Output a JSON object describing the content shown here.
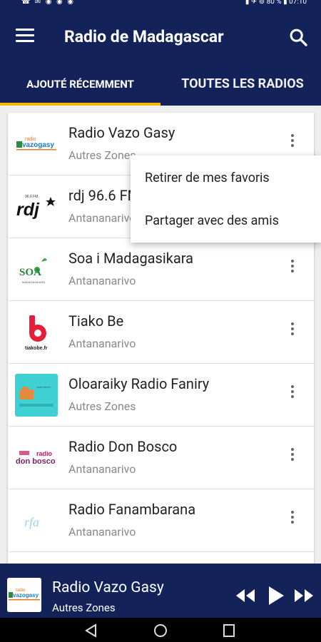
{
  "statusbar": {
    "left_icons": "☎ ✉ ◉ ◉ ◉",
    "right_text": "▮ ✈ ⊚ 80 % ▮ 07:10"
  },
  "appbar": {
    "title": "Radio de Madagascar"
  },
  "tabs": [
    {
      "label": "AJOUTÉ RÉCEMMENT",
      "active": true
    },
    {
      "label": "TOUTES LES RADIOS",
      "active": false
    }
  ],
  "stations": [
    {
      "name": "Radio Vazo Gasy",
      "location": "Autres Zones",
      "logo": "vazogasy-logo"
    },
    {
      "name": "rdj 96.6 FM",
      "location": "Antananarivo",
      "logo": "rdj-logo"
    },
    {
      "name": "Soa i Madagasikara",
      "location": "Antananarivo",
      "logo": "soa-logo"
    },
    {
      "name": "Tiako Be",
      "location": "Antananarivo",
      "logo": "tiakobe-logo"
    },
    {
      "name": "Oloaraiky Radio Faniry",
      "location": "Autres Zones",
      "logo": "faniry-logo"
    },
    {
      "name": "Radio Don Bosco",
      "location": "Antananarivo",
      "logo": "donbosco-logo"
    },
    {
      "name": "Radio Fanambarana",
      "location": "Antananarivo",
      "logo": "rfa-logo"
    }
  ],
  "logos": {
    "vazogasy_top": "radio",
    "vazogasy_main": "vazogasy",
    "rdj": "rdj",
    "rdj_freq": "96.6 FM",
    "soa": "SOA",
    "soa_sub": "MADAGASIKARA",
    "tiakobe": "tiakobe.fr",
    "faniry": "radio faniry",
    "donbosco_top": "radio",
    "donbosco_main": "don bosco",
    "rfa": "rfa"
  },
  "popup_menu": {
    "items": [
      "Retirer de mes favoris",
      "Partager avec des amis"
    ]
  },
  "player": {
    "name": "Radio Vazo Gasy",
    "location": "Autres Zones"
  },
  "colors": {
    "primary": "#13235a",
    "accent": "#f3b700"
  }
}
